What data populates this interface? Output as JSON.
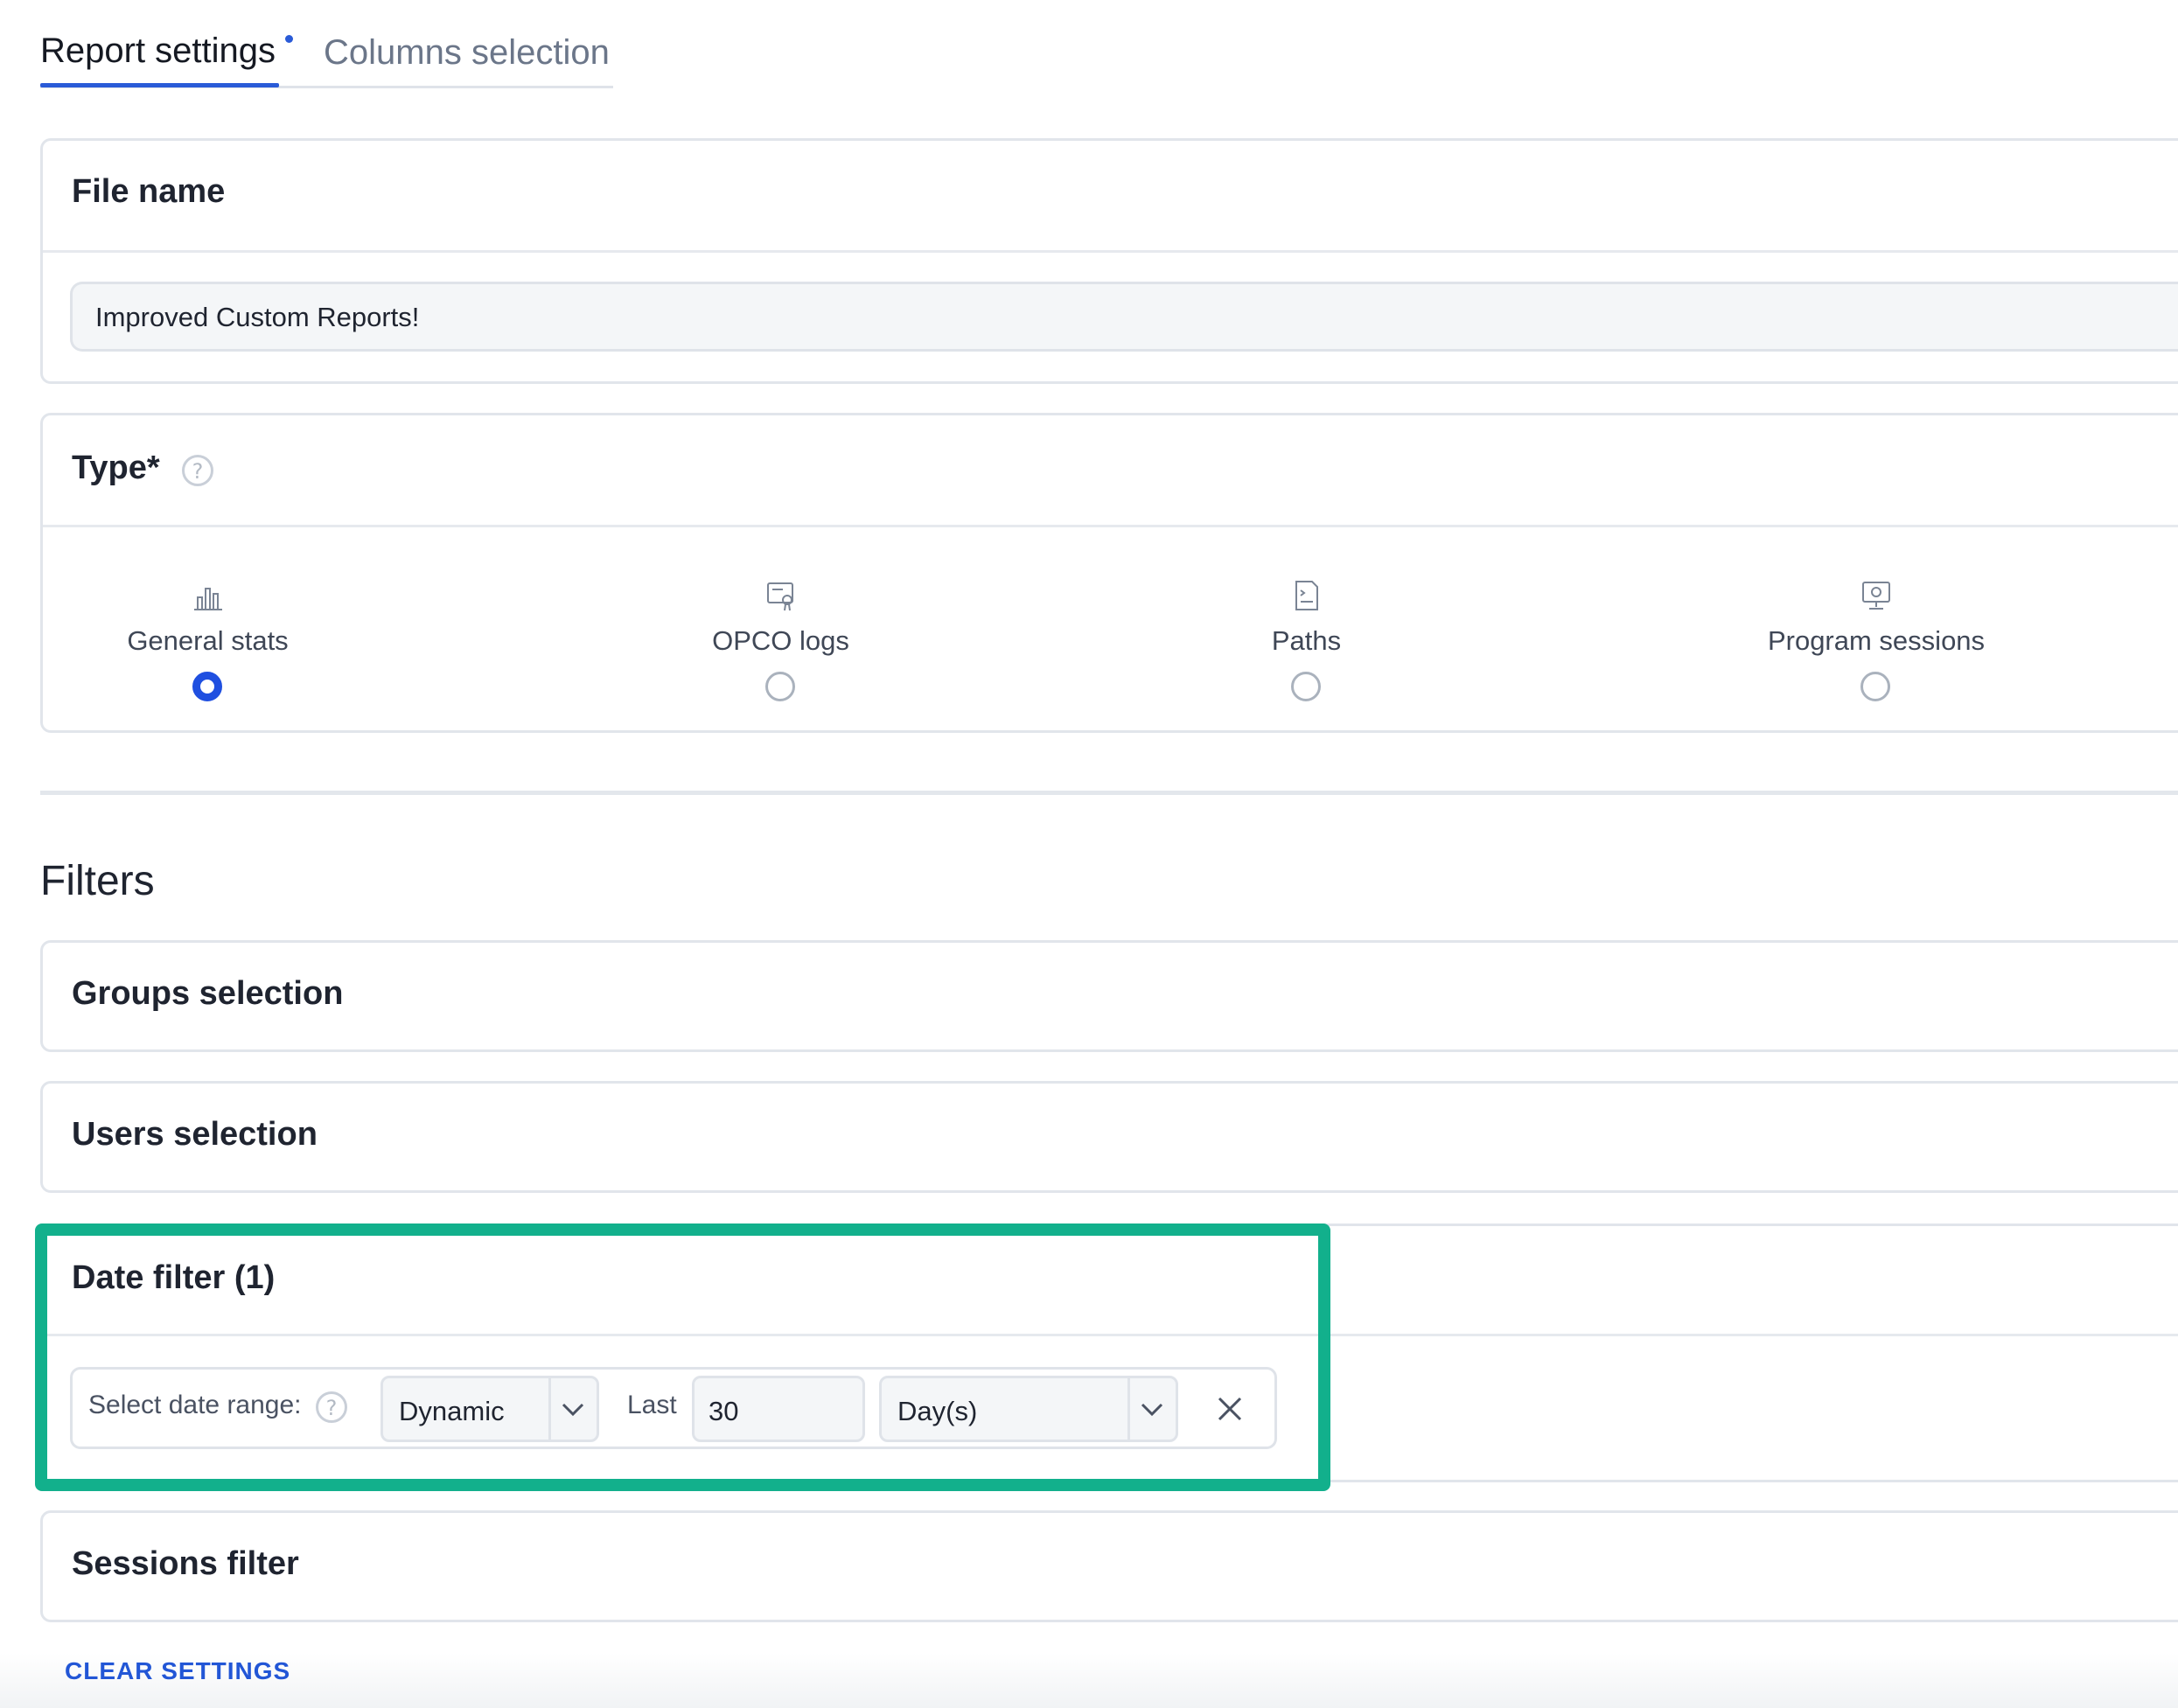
{
  "tabs": [
    {
      "label": "Report settings",
      "active": true,
      "has_unsaved_dot": true
    },
    {
      "label": "Columns selection",
      "active": false
    }
  ],
  "file_name": {
    "title": "File name",
    "value": "Improved Custom Reports!"
  },
  "type": {
    "title": "Type*",
    "help_icon": "question-circle-icon",
    "options": [
      {
        "label": "General stats",
        "icon": "bar-chart-icon",
        "selected": true
      },
      {
        "label": "OPCO logs",
        "icon": "certificate-icon",
        "selected": false
      },
      {
        "label": "Paths",
        "icon": "document-icon",
        "selected": false
      },
      {
        "label": "Program sessions",
        "icon": "monitor-icon",
        "selected": false
      }
    ]
  },
  "filters": {
    "title": "Filters",
    "groups_title": "Groups selection",
    "users_title": "Users selection",
    "date_filter": {
      "title": "Date filter (1)",
      "range_label": "Select date range:",
      "mode_value": "Dynamic",
      "last_label": "Last",
      "amount_value": "30",
      "unit_value": "Day(s)",
      "remove_icon": "close-icon"
    },
    "sessions_title": "Sessions filter"
  },
  "clear_button": "CLEAR SETTINGS",
  "colors": {
    "accent": "#2a5bd7",
    "radio_checked": "#1f4fe0",
    "highlight": "#12b08c"
  }
}
